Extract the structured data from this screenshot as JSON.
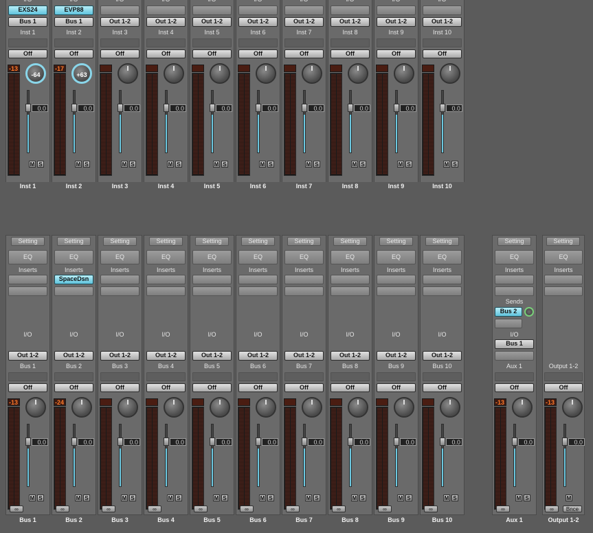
{
  "labels": {
    "io": "I/O",
    "setting": "Setting",
    "eq": "EQ",
    "inserts": "Inserts",
    "sends": "Sends",
    "off": "Off",
    "mute": "M",
    "solo": "S",
    "bounce": "Bnce",
    "link": "∞"
  },
  "top_strips": [
    {
      "instrument": "EXS24",
      "output": "Bus 1",
      "out_selected": false,
      "inst_selected": true,
      "group": "Inst 1",
      "name": "Inst 1",
      "peak": "-13",
      "pan": "-64",
      "volume": "0.0",
      "level": 0.6
    },
    {
      "instrument": "EVP88",
      "output": "Bus 1",
      "out_selected": false,
      "inst_selected": true,
      "group": "Inst 2",
      "name": "Inst 2",
      "peak": "-17",
      "pan": "+63",
      "volume": "0.0",
      "level": 0.6
    },
    {
      "instrument": "",
      "output": "Out 1-2",
      "group": "Inst 3",
      "name": "Inst 3",
      "peak": "",
      "pan": "",
      "volume": "0.0",
      "level": 0.6
    },
    {
      "instrument": "",
      "output": "Out 1-2",
      "group": "Inst 4",
      "name": "Inst 4",
      "peak": "",
      "pan": "",
      "volume": "0.0",
      "level": 0.6
    },
    {
      "instrument": "",
      "output": "Out 1-2",
      "group": "Inst 5",
      "name": "Inst 5",
      "peak": "",
      "pan": "",
      "volume": "0.0",
      "level": 0.6
    },
    {
      "instrument": "",
      "output": "Out 1-2",
      "group": "Inst 6",
      "name": "Inst 6",
      "peak": "",
      "pan": "",
      "volume": "0.0",
      "level": 0.6
    },
    {
      "instrument": "",
      "output": "Out 1-2",
      "group": "Inst 7",
      "name": "Inst 7",
      "peak": "",
      "pan": "",
      "volume": "0.0",
      "level": 0.6
    },
    {
      "instrument": "",
      "output": "Out 1-2",
      "group": "Inst 8",
      "name": "Inst 8",
      "peak": "",
      "pan": "",
      "volume": "0.0",
      "level": 0.6
    },
    {
      "instrument": "",
      "output": "Out 1-2",
      "group": "Inst 9",
      "name": "Inst 9",
      "peak": "",
      "pan": "",
      "volume": "0.0",
      "level": 0.6
    },
    {
      "instrument": "",
      "output": "Out 1-2",
      "group": "Inst 10",
      "name": "Inst 10",
      "peak": "",
      "pan": "",
      "volume": "0.0",
      "level": 0.6
    }
  ],
  "bottom_strips": [
    {
      "insert": "",
      "output": "Out 1-2",
      "group": "Bus 1",
      "name": "Bus 1",
      "peak": "-13",
      "volume": "0.0",
      "level": 0.6
    },
    {
      "insert": "SpaceDsn",
      "output": "Out 1-2",
      "group": "Bus 2",
      "name": "Bus 2",
      "peak": "-24",
      "volume": "0.0",
      "level": 0.6
    },
    {
      "insert": "",
      "output": "Out 1-2",
      "group": "Bus 3",
      "name": "Bus 3",
      "peak": "",
      "volume": "0.0",
      "level": 0.6
    },
    {
      "insert": "",
      "output": "Out 1-2",
      "group": "Bus 4",
      "name": "Bus 4",
      "peak": "",
      "volume": "0.0",
      "level": 0.6
    },
    {
      "insert": "",
      "output": "Out 1-2",
      "group": "Bus 5",
      "name": "Bus 5",
      "peak": "",
      "volume": "0.0",
      "level": 0.6
    },
    {
      "insert": "",
      "output": "Out 1-2",
      "group": "Bus 6",
      "name": "Bus 6",
      "peak": "",
      "volume": "0.0",
      "level": 0.6
    },
    {
      "insert": "",
      "output": "Out 1-2",
      "group": "Bus 7",
      "name": "Bus 7",
      "peak": "",
      "volume": "0.0",
      "level": 0.6
    },
    {
      "insert": "",
      "output": "Out 1-2",
      "group": "Bus 8",
      "name": "Bus 8",
      "peak": "",
      "volume": "0.0",
      "level": 0.6
    },
    {
      "insert": "",
      "output": "Out 1-2",
      "group": "Bus 9",
      "name": "Bus 9",
      "peak": "",
      "volume": "0.0",
      "level": 0.6
    },
    {
      "insert": "",
      "output": "Out 1-2",
      "group": "Bus 10",
      "name": "Bus 10",
      "peak": "",
      "volume": "0.0",
      "level": 0.6
    }
  ],
  "aux": {
    "send": "Bus 2",
    "input": "Bus 1",
    "group": "Aux 1",
    "name": "Aux 1",
    "peak": "-13",
    "volume": "0.0",
    "level": 0.6
  },
  "output": {
    "group": "Output 1-2",
    "name": "Output 1-2",
    "peak": "-13",
    "volume": "0.0",
    "level": 0.6
  },
  "colors": {
    "accent": "#6cc8e0",
    "peak": "#ff7a2a",
    "background": "#5b5b5b"
  }
}
